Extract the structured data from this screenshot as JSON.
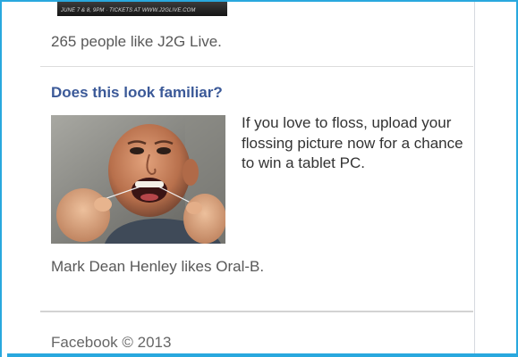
{
  "page_like": {
    "banner_text": "JUNE 7 & 8, 9PM · TICKETS AT WWW.J2GLIVE.COM",
    "likes_text": "265 people like J2G Live."
  },
  "ad": {
    "title": "Does this look familiar?",
    "body": "If you love to floss, upload your flossing picture now for a chance to win a tablet PC.",
    "social_context": "Mark Dean Henley likes Oral-B."
  },
  "footer": {
    "copyright": "Facebook © 2013"
  },
  "colors": {
    "frame_border": "#29a8de",
    "ad_title": "#3b5998",
    "text_secondary": "#585858",
    "divider": "#dcdcdc"
  }
}
